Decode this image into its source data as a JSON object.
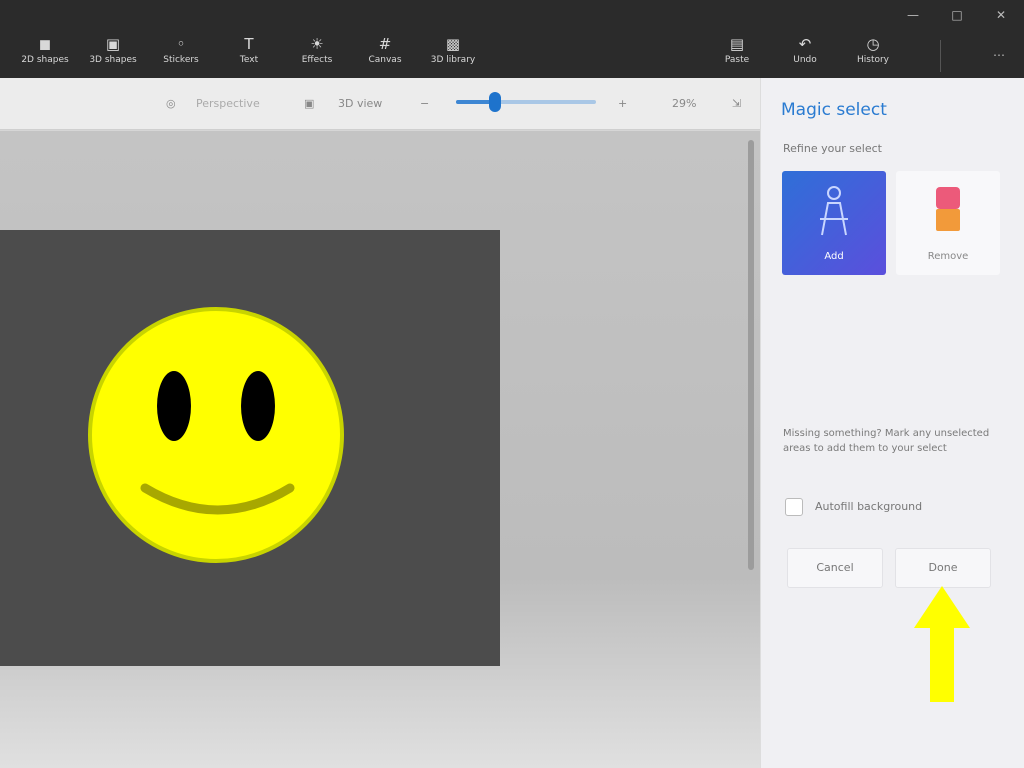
{
  "toolbar": {
    "buttons": [
      {
        "label": "2D shapes",
        "icon": "shapes-icon"
      },
      {
        "label": "3D shapes",
        "icon": "cube-icon"
      },
      {
        "label": "Stickers",
        "icon": "sticker-icon"
      },
      {
        "label": "Text",
        "icon": "text-icon"
      },
      {
        "label": "Effects",
        "icon": "effects-icon"
      },
      {
        "label": "Canvas",
        "icon": "canvas-icon"
      },
      {
        "label": "3D library",
        "icon": "library-icon"
      },
      {
        "label": "Paste",
        "icon": "paste-icon"
      },
      {
        "label": "Undo",
        "icon": "undo-icon"
      },
      {
        "label": "History",
        "icon": "history-icon"
      }
    ],
    "window_controls": [
      "minimize",
      "maximize",
      "close"
    ]
  },
  "subbar": {
    "view_label": "3D view",
    "mode_label": "Perspective",
    "zoom_percent": 29,
    "zoom_level": 0.28
  },
  "panel": {
    "title": "Magic select",
    "subtitle": "Refine your select",
    "cards": [
      {
        "label": "Add",
        "selected": true
      },
      {
        "label": "Remove",
        "selected": false
      }
    ],
    "note": "Missing something? Mark any unselected areas to add them to your select",
    "checkbox_label": "Autofill background",
    "checkbox_checked": false,
    "cancel_label": "Cancel",
    "next_label": "Done"
  },
  "colors": {
    "accent": "#2a7bd1",
    "toolbar_bg": "#2b2b2b",
    "canvas_bg": "#4c4c4c",
    "smiley_fill": "#ffff00",
    "arrow": "#ffff00"
  }
}
